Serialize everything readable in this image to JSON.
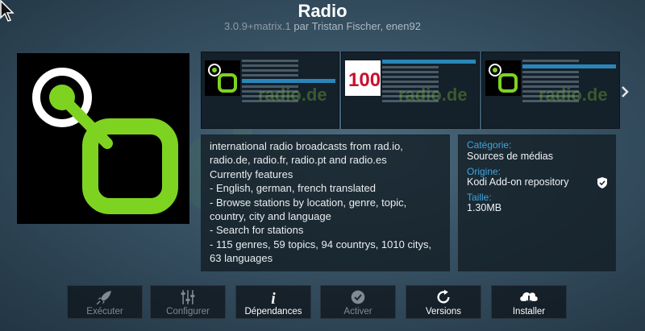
{
  "header": {
    "title": "Radio",
    "version": "3.0.9+matrix.1",
    "author_line": "par Tristan Fischer, enen92"
  },
  "screenshots": [
    {
      "name": "screenshot-1",
      "watermark": "radio.de"
    },
    {
      "name": "screenshot-2",
      "watermark": "radio.de"
    },
    {
      "name": "screenshot-3",
      "watermark": "radio.de"
    }
  ],
  "description": "international radio broadcasts from rad.io, radio.de, radio.fr, radio.pt and radio.es\nCurrently features\n- English, german, french translated\n- Browse stations by location, genre, topic, country, city and language\n- Search for stations\n- 115 genres, 59 topics, 94 countrys, 1010 citys, 63 languages",
  "info": {
    "category_label": "Catégorie:",
    "category_value": "Sources de médias",
    "origin_label": "Origine:",
    "origin_value": "Kodi Add-on repository",
    "size_label": "Taille:",
    "size_value": "1.30MB"
  },
  "buttons": [
    {
      "label": "Exécuter",
      "icon": "rocket-icon",
      "enabled": false
    },
    {
      "label": "Configurer",
      "icon": "sliders-icon",
      "enabled": false
    },
    {
      "label": "Dépendances",
      "icon": "info-icon",
      "enabled": true
    },
    {
      "label": "Activer",
      "icon": "check-circle-icon",
      "enabled": false
    },
    {
      "label": "Versions",
      "icon": "refresh-icon",
      "enabled": true
    },
    {
      "label": "Installer",
      "icon": "cloud-download-icon",
      "enabled": true
    }
  ],
  "colors": {
    "accent_green": "#7ed321",
    "label_blue": "#3fa6dd"
  }
}
